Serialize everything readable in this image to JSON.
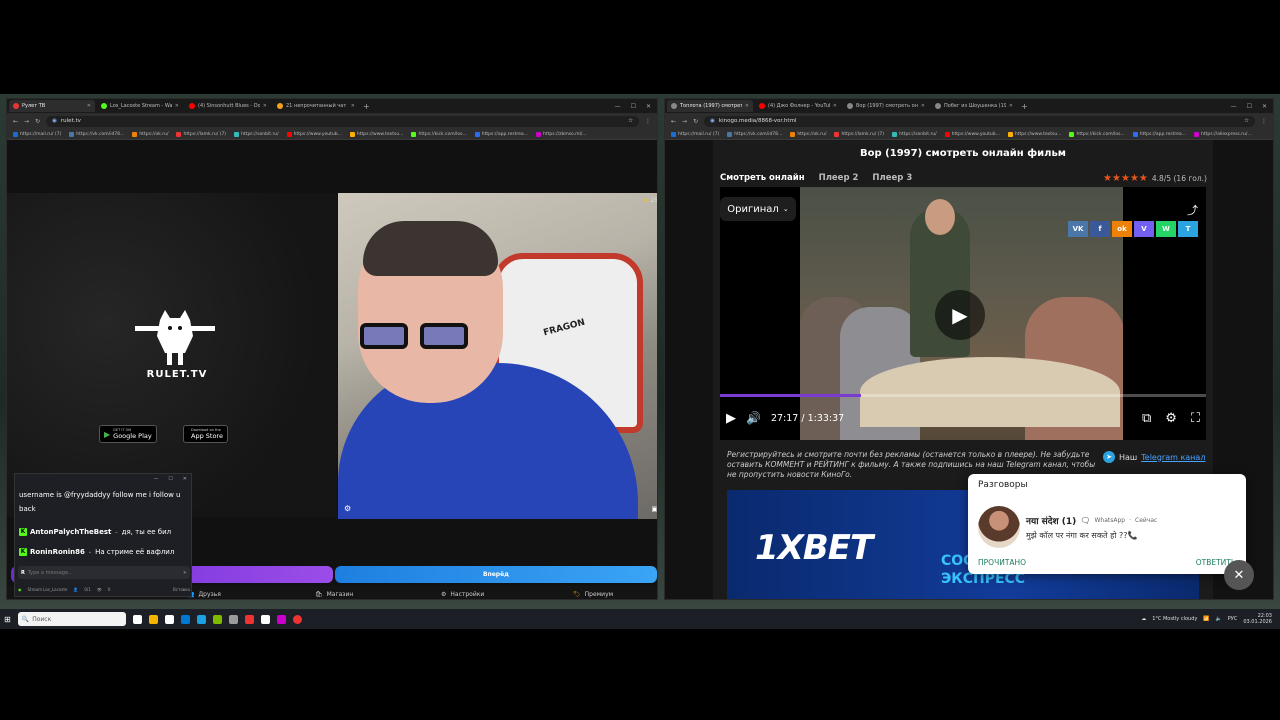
{
  "left_window": {
    "tabs": [
      {
        "label": "Рулет ТВ",
        "color": "#e33"
      },
      {
        "label": "Los_Lacoste Stream - Watch Li...",
        "color": "#53fc18"
      },
      {
        "label": "(4) Sinsonhutt Blues - Doce...",
        "color": "#f00"
      },
      {
        "label": "21 непрочитанный чат",
        "color": "#f4a21a"
      }
    ],
    "url": "rulet.tv",
    "bookmarks": [
      {
        "label": "https://mail.ru/ (7)",
        "color": "#1a6dd5"
      },
      {
        "label": "https://vk.com/id78...",
        "color": "#4a76a8"
      },
      {
        "label": "https://ok.ru/",
        "color": "#ee8208"
      },
      {
        "label": "https://lamk.ru/ (7)",
        "color": "#e33"
      },
      {
        "label": "https://sonbit.ru/",
        "color": "#3bb"
      },
      {
        "label": "https://www.youtub...",
        "color": "#f00"
      },
      {
        "label": "https://www.textsu...",
        "color": "#ffb000"
      },
      {
        "label": "https://kick.com/los...",
        "color": "#53fc18"
      },
      {
        "label": "https://app.restrea...",
        "color": "#2b6ef5"
      },
      {
        "label": "https://zbmso.ml/...",
        "color": "#c0c"
      }
    ],
    "logo_text": "RULET.TV",
    "google_play": {
      "small": "GET IT ON",
      "big": "Google Play"
    },
    "app_store": {
      "small": "Download on the",
      "big": "App Store"
    },
    "cam_stars": "25",
    "chair_text": "FRAGON",
    "start_button": "Вперёд",
    "nav": [
      {
        "label": "Друзья",
        "icon": "friends-icon"
      },
      {
        "label": "Магазин",
        "icon": "shop-icon"
      },
      {
        "label": "Настройки",
        "icon": "settings-icon"
      },
      {
        "label": "Премиум",
        "icon": "premium-icon"
      }
    ]
  },
  "chat": {
    "messages": [
      {
        "text": "username is @fryydaddyy follow me i follow u back"
      },
      {
        "user": "AntonPalychTheBest",
        "text": "дя, ты ее бил"
      },
      {
        "user": "RoninRonin86",
        "text": "На стриме её вафлил"
      }
    ],
    "placeholder": "Type a message...",
    "footer_channel": "Stream Los_Lacoste",
    "footer_count": "0/1",
    "footer_viewers": "0",
    "footer_right": "Вставка"
  },
  "right_window": {
    "tabs": [
      {
        "label": "Топлота (1997) смотреть онлай...",
        "color": "#888"
      },
      {
        "label": "(4) Джо Фолнер - YouTube",
        "color": "#f00"
      },
      {
        "label": "Вор (1997) смотреть онлайн ф...",
        "color": "#888"
      },
      {
        "label": "Побег из Шоушенка (1994) см...",
        "color": "#888"
      }
    ],
    "url": "kinogo.media/8868-vor.html",
    "bookmarks": [
      {
        "label": "https://mail.ru/ (7)",
        "color": "#1a6dd5"
      },
      {
        "label": "https://vk.com/id78...",
        "color": "#4a76a8"
      },
      {
        "label": "https://ok.ru/",
        "color": "#ee8208"
      },
      {
        "label": "https://lamk.ru/ (7)",
        "color": "#e33"
      },
      {
        "label": "https://sonbit.ru/",
        "color": "#3bb"
      },
      {
        "label": "https://www.youtub...",
        "color": "#f00"
      },
      {
        "label": "https://www.textsu...",
        "color": "#ffb000"
      },
      {
        "label": "https://kick.com/los...",
        "color": "#53fc18"
      },
      {
        "label": "https://app.restrea...",
        "color": "#2b6ef5"
      },
      {
        "label": "https://aliexpress.ru/...",
        "color": "#c0c"
      }
    ],
    "title": "Вор (1997) смотреть онлайн фильм",
    "player_tabs": [
      "Смотреть онлайн",
      "Плеер 2",
      "Плеер 3"
    ],
    "rating": "4.8/5 (16 гол.)",
    "rating_stars": 5,
    "quality": "Оригинал",
    "share_icons": [
      "VK",
      "f",
      "ok",
      "V",
      "W",
      "T"
    ],
    "time": "27:17 / 1:33:37",
    "progress": 0.29,
    "note": "Регистрируйтесь и смотрите почти без рекламы (останется только в плеере). Не забудьте оставить КОММЕНТ и РЕЙТИНГ к фильму. А также подпишись на наш Telegram канал, чтобы не пропустить новости КиноГо.",
    "tg_prefix": "Наш",
    "tg_link": "Telegram канал",
    "banner_brand": "1XBET",
    "banner_text_1": "СОС",
    "banner_text_2": "ЭКСПРЕСС"
  },
  "notification": {
    "header": "Разговоры",
    "sender": "नया संदेश (1)",
    "app": "WhatsApp",
    "time": "Сейчас",
    "text": "मुझे कॉल पर नंगा कर सकते हो ??📞",
    "read": "ПРОЧИТАНО",
    "reply": "ОТВЕТИТЬ"
  },
  "taskbar": {
    "search_placeholder": "Поиск",
    "weather": "1°C  Mostly cloudy",
    "lang": "РУС",
    "time": "22:03",
    "date": "03.01.2026"
  }
}
